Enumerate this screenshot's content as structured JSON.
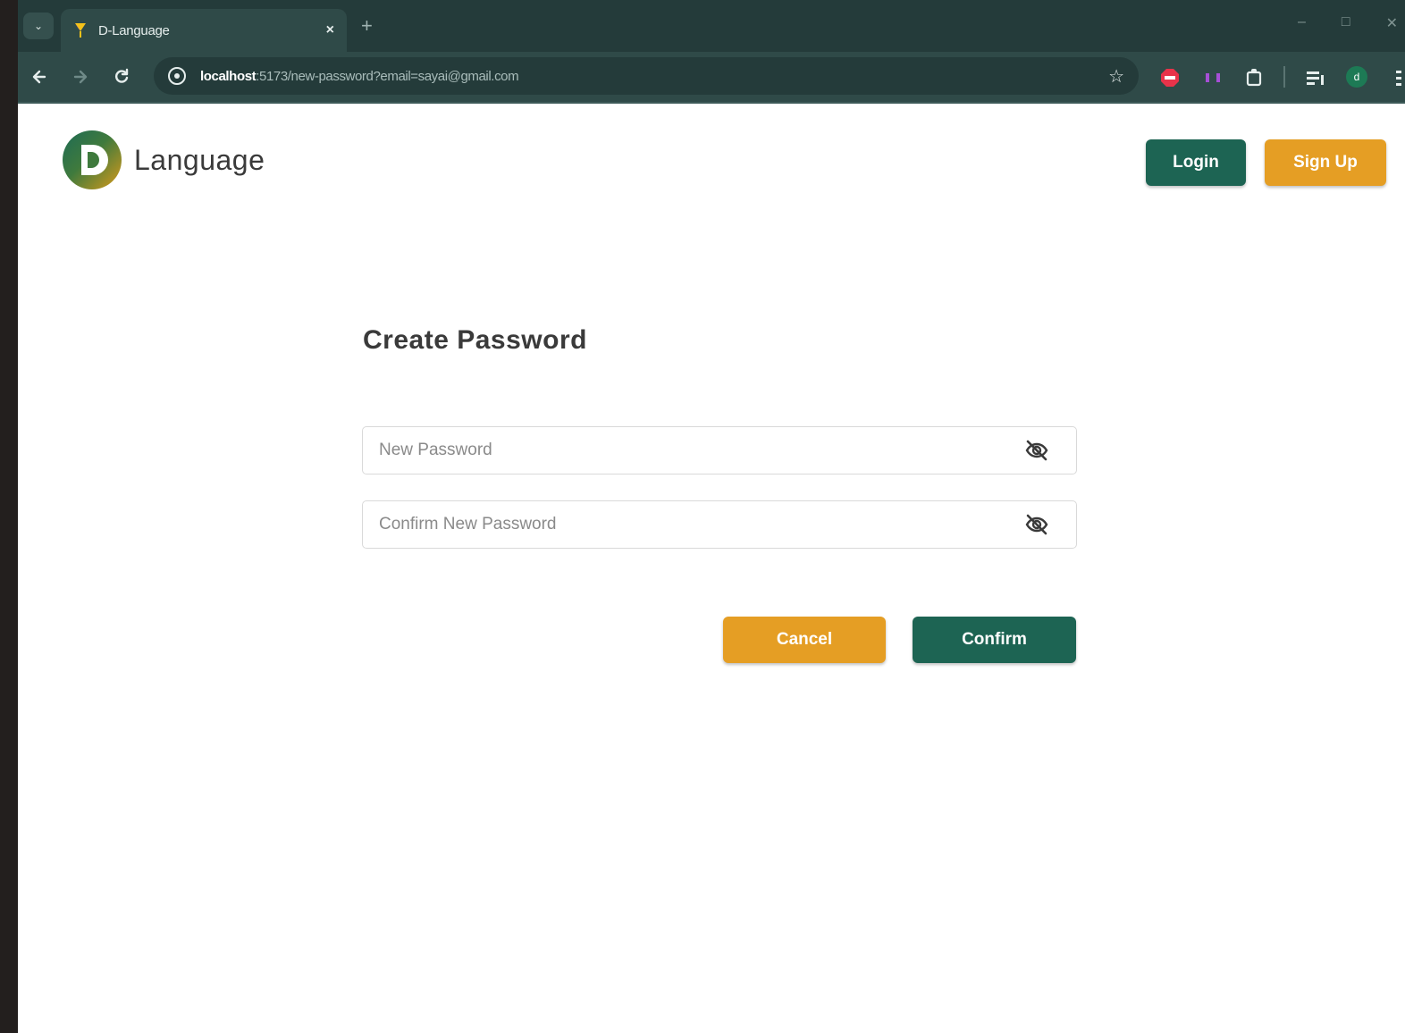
{
  "browser": {
    "tab_title": "D-Language",
    "close_glyph": "×",
    "new_tab_glyph": "+",
    "url_host": "localhost",
    "url_rest": ":5173/new-password?email=sayai@gmail.com",
    "minimize_glyph": "–",
    "maximize_glyph": "□",
    "close_window_glyph": "✕",
    "profile_initial": "d"
  },
  "header": {
    "brand_name": "Language",
    "login_label": "Login",
    "signup_label": "Sign Up"
  },
  "form": {
    "title": "Create Password",
    "new_password_placeholder": "New Password",
    "confirm_password_placeholder": "Confirm New Password",
    "cancel_label": "Cancel",
    "confirm_label": "Confirm"
  },
  "colors": {
    "brand_green": "#1d6453",
    "brand_orange": "#e59e24",
    "browser_frame": "#243b3a"
  }
}
